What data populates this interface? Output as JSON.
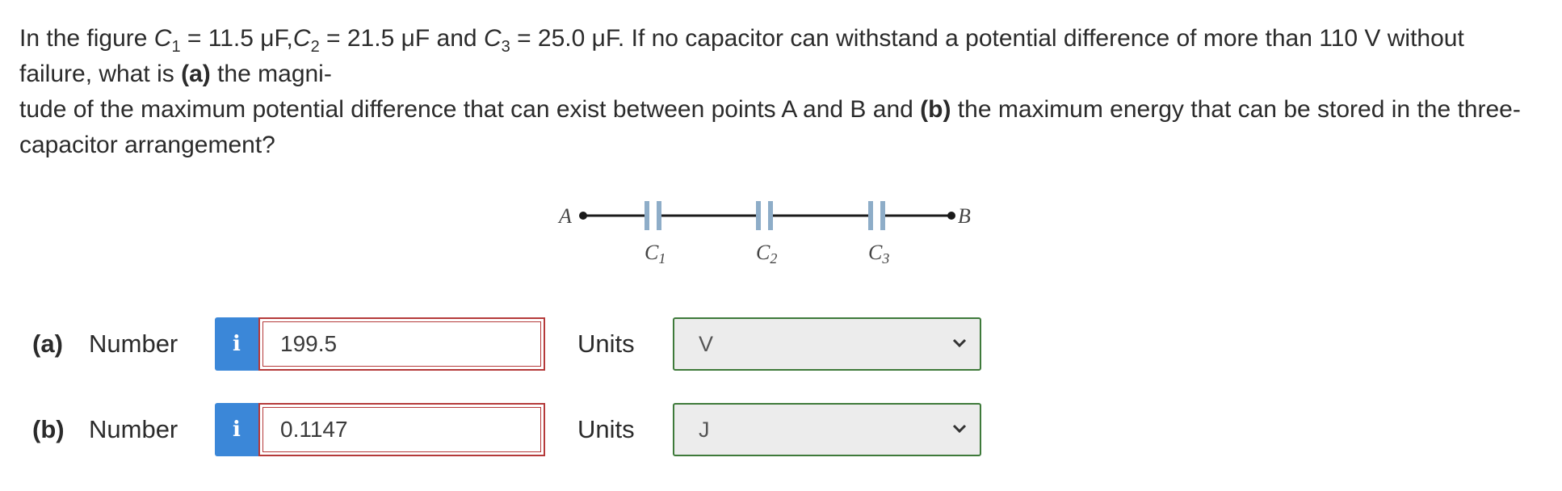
{
  "question": {
    "line1_prefix": "In the figure ",
    "c1_var": "C",
    "c1_sub": "1",
    "c1_eq": " = 11.5 μF,",
    "c2_var": "C",
    "c2_sub": "2",
    "c2_eq": " = 21.5 μF and ",
    "c3_var": "C",
    "c3_sub": "3",
    "c3_eq": " = 25.0 μF. If no capacitor can withstand a potential difference of more than 110 V without failure, what is ",
    "part_a_marker": "(a)",
    "line1_end": " the magni-",
    "line3_start": "tude of the maximum potential difference that can exist between points A and B and ",
    "part_b_marker": "(b)",
    "line3_end": " the maximum energy that can be stored in the three-capacitor arrangement?"
  },
  "figure": {
    "point_a": "A",
    "point_b": "B",
    "cap1_letter": "C",
    "cap1_sub": "1",
    "cap2_letter": "C",
    "cap2_sub": "2",
    "cap3_letter": "C",
    "cap3_sub": "3",
    "wire_color": "#1a1a1a",
    "plate_color": "#8eadc8"
  },
  "answers": [
    {
      "part": "(a)",
      "number_label": "Number",
      "info_icon": "i",
      "value": "199.5",
      "units_label": "Units",
      "unit": "V"
    },
    {
      "part": "(b)",
      "number_label": "Number",
      "info_icon": "i",
      "value": "0.1147",
      "units_label": "Units",
      "unit": "J"
    }
  ],
  "colors": {
    "info_button": "#3b87d8",
    "incorrect_border": "#b53a3a",
    "select_border": "#3e7a3a"
  }
}
